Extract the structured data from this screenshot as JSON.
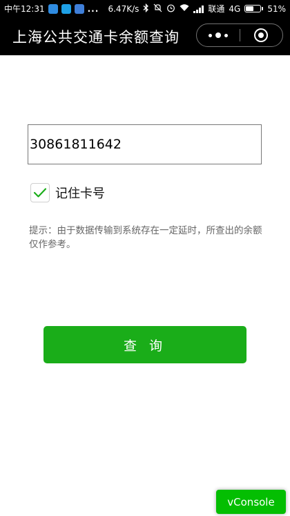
{
  "status_bar": {
    "time": "中午12:31",
    "more": "...",
    "speed": "6.47K/s",
    "carrier": "联通",
    "network": "4G",
    "battery_percent": "51%",
    "battery_level": 0.51,
    "icons": [
      "navigation-app-icon",
      "app-icon",
      "app-icon",
      "bluetooth-icon",
      "mute-icon",
      "alarm-icon",
      "wifi-icon",
      "signal-icon",
      "battery-icon"
    ]
  },
  "title_bar": {
    "title": "上海公共交通卡余额查询",
    "background_color": "#000000"
  },
  "form": {
    "card_number": "30861811642",
    "remember_label": "记住卡号",
    "remember_checked": true,
    "hint": "提示：由于数据传输到系统存在一定延时，所查出的余额仅作参考。"
  },
  "query_button": {
    "label": "查 询",
    "color": "#1aad19"
  },
  "vconsole": {
    "label": "vConsole",
    "color": "#04be02"
  }
}
